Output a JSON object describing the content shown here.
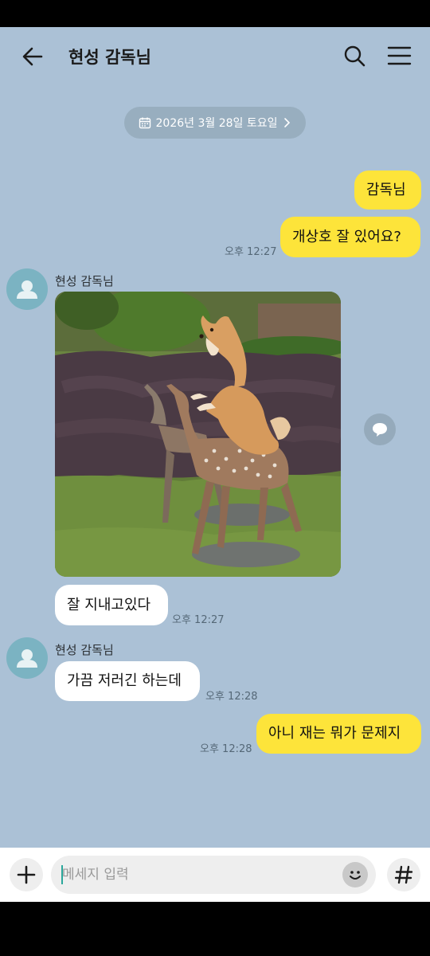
{
  "header": {
    "title": "현성 감독님",
    "back_icon": "arrow-left-icon",
    "search_icon": "search-icon",
    "menu_icon": "hamburger-menu-icon"
  },
  "date_divider": {
    "label": "2026년 3월 28일 토요일",
    "icon": "calendar-icon",
    "chevron": "chevron-right-icon"
  },
  "messages": [
    {
      "from": "me",
      "text": "감독님"
    },
    {
      "from": "me",
      "text": "개상호 잘 있어요?",
      "time": "오후 12:27"
    },
    {
      "from": "other",
      "sender": "현성 감독님",
      "type": "image",
      "image_desc": "shiba-dog-on-deer-statue-photo"
    },
    {
      "from": "other",
      "text": "잘 지내고있다",
      "time": "오후 12:27"
    },
    {
      "from": "other",
      "sender": "현성 감독님",
      "text": "가끔 저러긴 하는데",
      "time": "오후 12:28"
    },
    {
      "from": "me",
      "text": "아니 재는 뭐가 문제지",
      "time": "오후 12:28"
    }
  ],
  "input_bar": {
    "placeholder": "메세지 입력",
    "value": "",
    "plus_icon": "plus-icon",
    "emoji_icon": "smiley-icon",
    "hash_icon": "hash-icon"
  },
  "colors": {
    "chat_background": "#abc1d6",
    "my_bubble": "#fde43a",
    "other_bubble": "#ffffff",
    "avatar": "#7bb3c2"
  }
}
